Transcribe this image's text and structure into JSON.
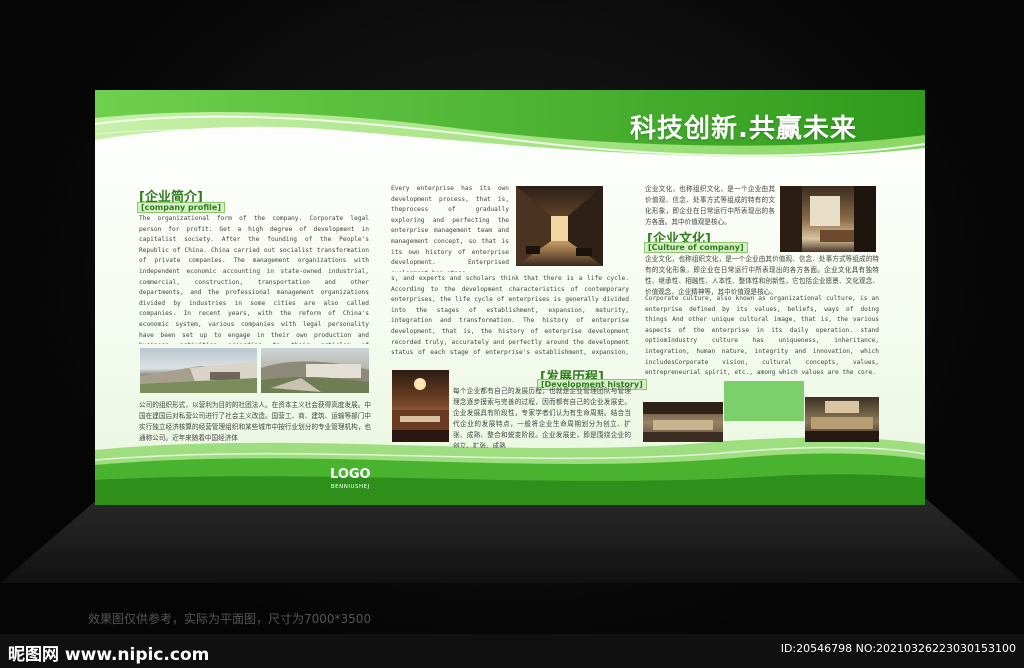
{
  "headline": "科技创新.共赢未来",
  "profile": {
    "title": "[企业简介]",
    "subtitle": "[company profile]",
    "body_en": "The organizational form of the company. Corporate legal person for profit. Get a high degree of development in capitalist society. After the founding of the People's Republic of China. China carried out socialist transformation of private companies. The management organizations with independent economic accounting in state-owned industrial, commercial, construction, transportation and other departments, and the professional management organizations divided by industries in some cities are also called companies. In recent years, with the reform of China's economic system, various companies with legal personality have been set up to engage in their own production and business activities according to their articles of association.",
    "body_cn": "公司的组织形式，以营利为目的的社团法人。在资本主义社会获得高度发展。中国在建国后对私营公司进行了社会主义改造。国营工、商、建筑、运输等部门中实行独立经济核算的经营管理组织和某些城市中按行业划分的专业管理机构，也通称公司。近年来随着中国经济体"
  },
  "middle": {
    "body_en": "Every enterprise has its own development process, that is, theprocess of gradually exploring and perfecting the enterprise management team and management concept, so that is its own history of enterprise development. Enterprised evelopment has stage s, and experts and scholars think that there is a life cycle. According to the development characteristics of contemporary enterprises, the life cycle of enterprises is generally divided into the stages of establishment, expansion, maturity, integration and transformation. The history of enterprise development, that is, the history of enterprise development recorded truly, accurately and perfectly around the development status of each stage of enterprise's establishment, expansion, maturity, integration and transformation."
  },
  "history": {
    "title": "[发展历程]",
    "subtitle": "[Development history]",
    "body_cn": "每个企业都有自己的发展历程，也就是企业管理团队与管理理念逐步摸索与完善的过程，因而都有自己的企业发展史。企业发展具有阶段性，专家学者们认为有生命周期。结合当代企业的发展特点，一般将企业生命周期划分为创立、扩张、成熟、整合和蜕变阶段。企业发展史，即是围绕企业的创立、扩张、成熟"
  },
  "culture": {
    "title": "[企业文化]",
    "subtitle": "[Culture of company]",
    "body_cn_top": "企业文化，也称组织文化，是一个企业由其价值观、信念、处事方式等组成的特有的文化形象，即企业在日常运行中所表现出的各方各面。其中价值观是核心。",
    "body_cn_mid": "企业文化，也称组织文化，是一个企业由其价值观、信念、处事方式等组成的特有的文化形象，即企业在日常运行中所表现出的各方各面。企业文化具有独特性、继承性、相融性、人本性、整体性和创新性，它包括企业愿景、文化观念、价值观念、企业精神等，其中价值观是核心。",
    "body_en": "Corporate culture, also known as organizational culture, is an enterprise defined by its values, beliefs, ways of doing things And other unique cultural image, that is, the various aspects of the enterprise in its daily operation. stand optiomIndustry culture has uniqueness, inheritance, integration, human nature, integrity and innovation, which includesCorporate vision, cultural concepts, values, entrepreneurial spirit, etc., among which values are the core."
  },
  "logo": {
    "main": "LOGO",
    "sub": "BENNIUSHEJ"
  },
  "caption": "效果图仅供参考，实际为平面图，尺寸为7000*3500",
  "watermark": {
    "left": "昵图网 www.nipic.com",
    "right": "ID:20546798 NO:20210326223030153100"
  },
  "colors": {
    "brand_green": "#3aa52a",
    "dark_green": "#2f7d1d",
    "light_green": "#bfe8a8",
    "block_green": "#7ccf6a"
  }
}
